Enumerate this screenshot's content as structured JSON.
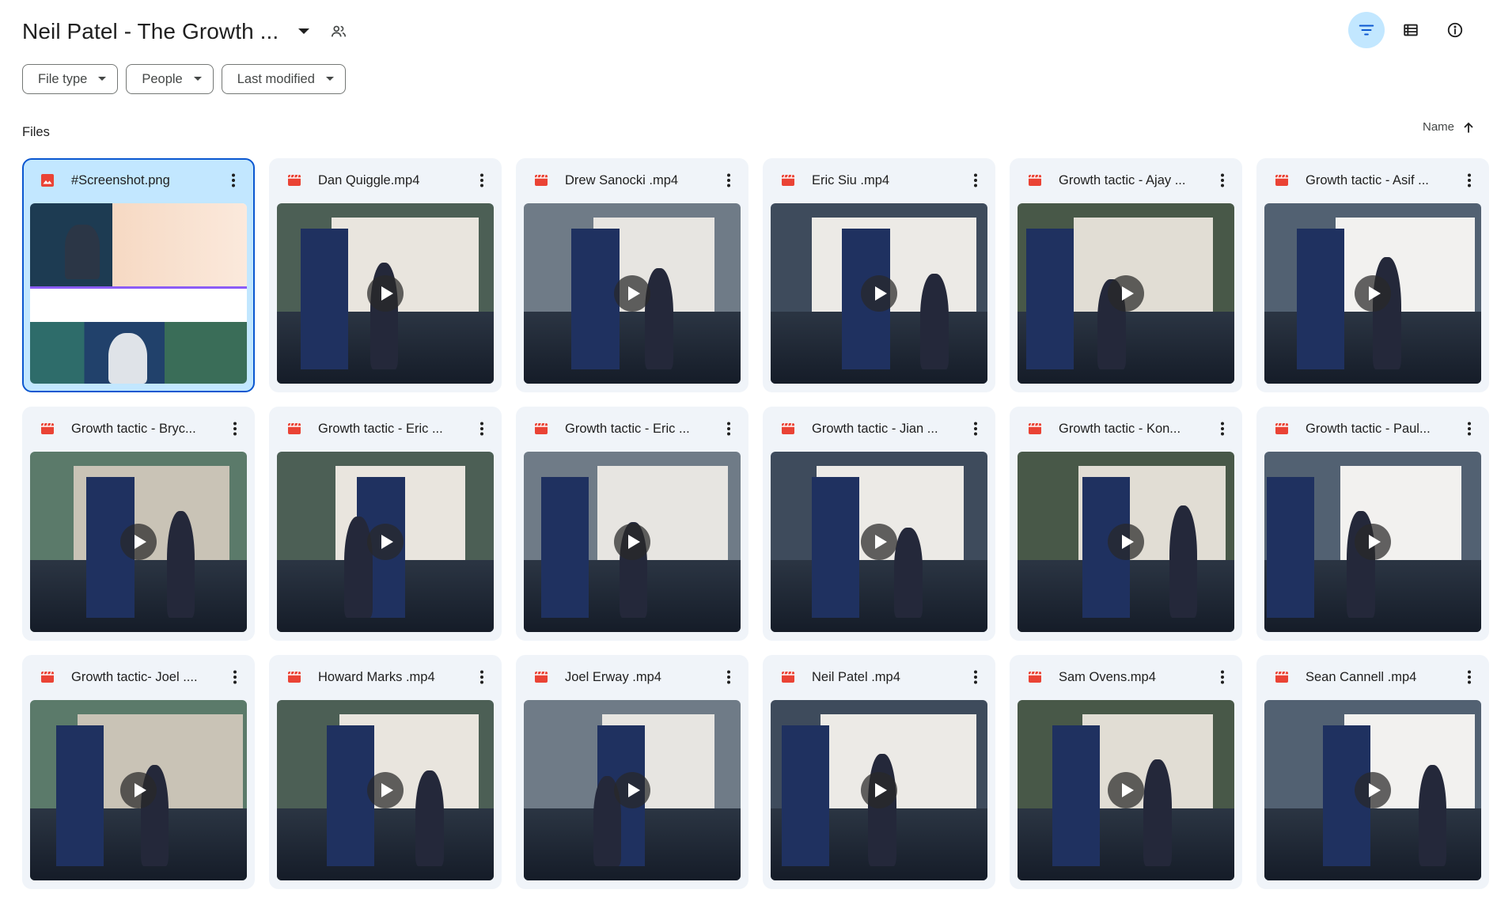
{
  "header": {
    "folder_title": "Neil Patel - The Growth ...",
    "icons": {
      "caret": "arrow-drop-down-icon",
      "share": "people-icon",
      "filter": "filter-list-icon",
      "list_view": "list-view-icon",
      "details": "info-icon"
    },
    "filter_active": true
  },
  "filters": [
    {
      "label": "File type"
    },
    {
      "label": "People"
    },
    {
      "label": "Last modified"
    }
  ],
  "section": {
    "label": "Files",
    "sort_label": "Name",
    "sort_direction": "ascending"
  },
  "colors": {
    "accent": "#0b57d0",
    "active_bg": "#c2e7ff",
    "card_bg": "#f0f4f9",
    "video_icon": "#ea4335",
    "image_icon": "#ea4335"
  },
  "files": [
    {
      "name": "#Screenshot.png",
      "type": "image",
      "icon": "image-file-icon",
      "selected": true
    },
    {
      "name": "Dan Quiggle.mp4",
      "type": "video",
      "icon": "video-file-icon"
    },
    {
      "name": "Drew Sanocki .mp4",
      "type": "video",
      "icon": "video-file-icon"
    },
    {
      "name": "Eric Siu .mp4",
      "type": "video",
      "icon": "video-file-icon"
    },
    {
      "name": "Growth tactic - Ajay ...",
      "type": "video",
      "icon": "video-file-icon"
    },
    {
      "name": "Growth tactic - Asif ...",
      "type": "video",
      "icon": "video-file-icon"
    },
    {
      "name": "Growth tactic - Bryc...",
      "type": "video",
      "icon": "video-file-icon"
    },
    {
      "name": "Growth tactic - Eric ...",
      "type": "video",
      "icon": "video-file-icon"
    },
    {
      "name": "Growth tactic - Eric ...",
      "type": "video",
      "icon": "video-file-icon"
    },
    {
      "name": "Growth tactic - Jian ...",
      "type": "video",
      "icon": "video-file-icon"
    },
    {
      "name": "Growth tactic - Kon...",
      "type": "video",
      "icon": "video-file-icon"
    },
    {
      "name": "Growth tactic - Paul...",
      "type": "video",
      "icon": "video-file-icon"
    },
    {
      "name": "Growth tactic- Joel ....",
      "type": "video",
      "icon": "video-file-icon"
    },
    {
      "name": "Howard Marks .mp4",
      "type": "video",
      "icon": "video-file-icon"
    },
    {
      "name": "Joel Erway .mp4",
      "type": "video",
      "icon": "video-file-icon"
    },
    {
      "name": "Neil Patel .mp4",
      "type": "video",
      "icon": "video-file-icon"
    },
    {
      "name": "Sam Ovens.mp4",
      "type": "video",
      "icon": "video-file-icon"
    },
    {
      "name": "Sean Cannell .mp4",
      "type": "video",
      "icon": "video-file-icon"
    }
  ]
}
